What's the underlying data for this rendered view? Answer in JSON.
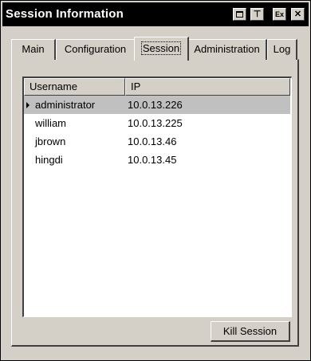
{
  "window": {
    "title": "Session Information",
    "title_buttons": {
      "pin_symbol": "⊤",
      "exit_symbol": "Ex",
      "close_symbol": "✕"
    }
  },
  "tabs": [
    {
      "label": "Main",
      "active": false
    },
    {
      "label": "Configuration",
      "active": false
    },
    {
      "label": "Session",
      "active": true
    },
    {
      "label": "Administration",
      "active": false
    },
    {
      "label": "Log",
      "active": false
    }
  ],
  "session_table": {
    "columns": [
      "Username",
      "IP"
    ],
    "rows": [
      {
        "username": "administrator",
        "ip": "10.0.13.226",
        "selected": true
      },
      {
        "username": "william",
        "ip": "10.0.13.225",
        "selected": false
      },
      {
        "username": "jbrown",
        "ip": "10.0.13.46",
        "selected": false
      },
      {
        "username": "hingdi",
        "ip": "10.0.13.45",
        "selected": false
      }
    ]
  },
  "actions": {
    "kill_session_label": "Kill Session"
  }
}
